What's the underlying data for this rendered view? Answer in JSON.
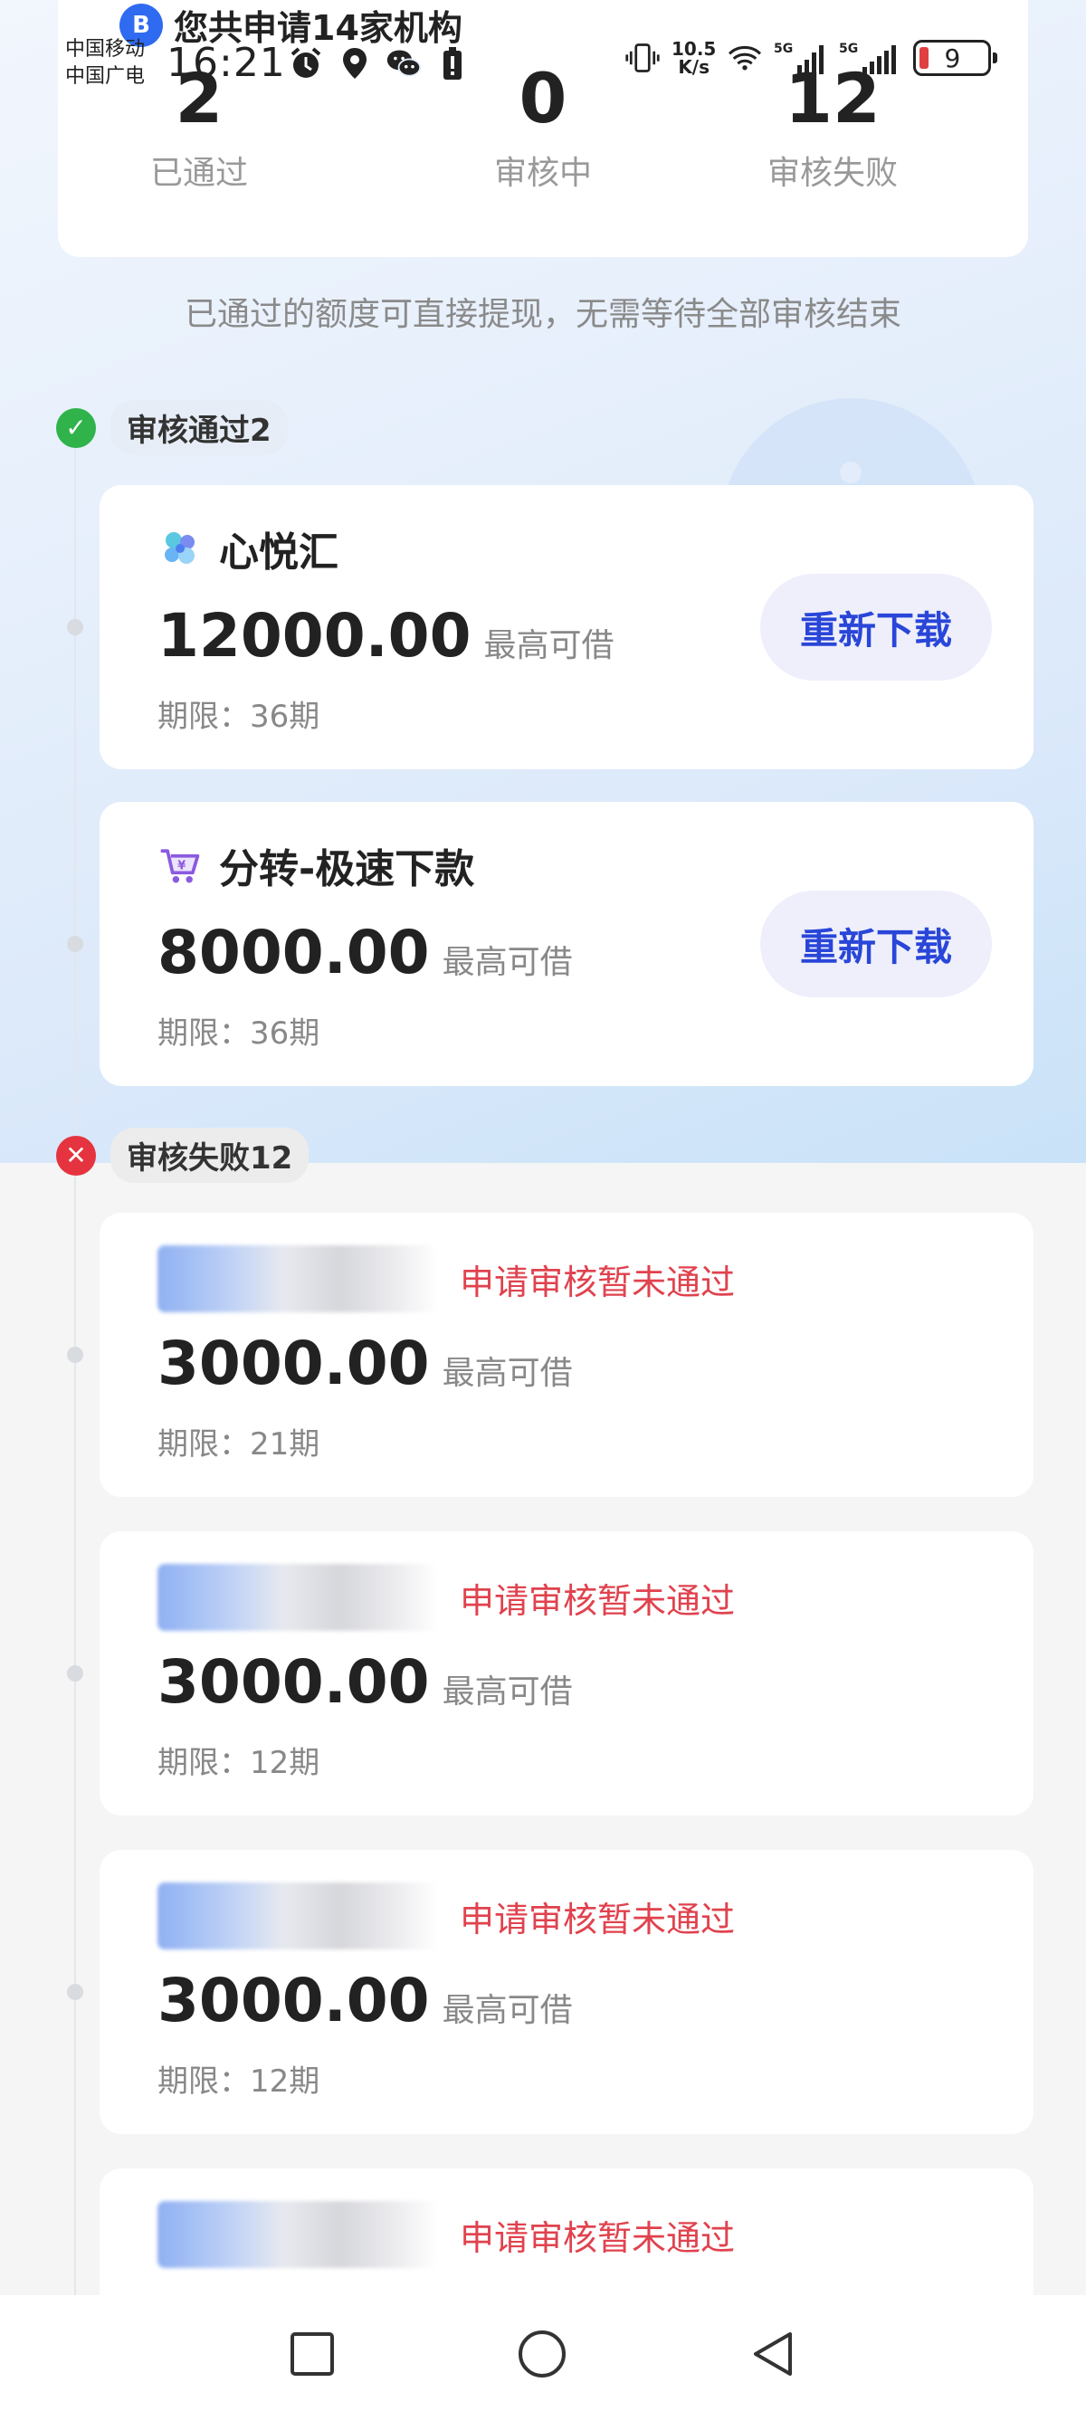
{
  "status_bar": {
    "carrier_1": "中国移动",
    "carrier_2": "中国广电",
    "time": "16:21",
    "net_speed_value": "10.5",
    "net_speed_unit": "K/s",
    "signal_1": "5G",
    "signal_2": "5G",
    "battery": "9",
    "icons_left": [
      "alarm-icon",
      "location-icon",
      "wechat-icon",
      "battery-saver-icon"
    ],
    "icons_right": [
      "vibrate-icon",
      "wifi-icon",
      "signal-icon",
      "signal-icon"
    ]
  },
  "notification": {
    "badge": "B",
    "text": "您共申请14家机构"
  },
  "summary": {
    "stats": [
      {
        "value": "2",
        "label": "已通过"
      },
      {
        "value": "0",
        "label": "审核中"
      },
      {
        "value": "12",
        "label": "审核失败"
      }
    ],
    "hint": "已通过的额度可直接提现，无需等待全部审核结束"
  },
  "sections": {
    "approved_label": "审核通过2",
    "failed_label": "审核失败12"
  },
  "approved": [
    {
      "name": "心悦汇",
      "amount": "12000.00",
      "amount_label": "最高可借",
      "term": "期限：36期",
      "button": "重新下载",
      "logo": "flower-logo-icon"
    },
    {
      "name": "分转-极速下款",
      "amount": "8000.00",
      "amount_label": "最高可借",
      "term": "期限：36期",
      "button": "重新下载",
      "logo": "cart-logo-icon"
    }
  ],
  "failed": [
    {
      "status": "申请审核暂未通过",
      "amount": "3000.00",
      "amount_label": "最高可借",
      "term": "期限：21期"
    },
    {
      "status": "申请审核暂未通过",
      "amount": "3000.00",
      "amount_label": "最高可借",
      "term": "期限：12期"
    },
    {
      "status": "申请审核暂未通过",
      "amount": "3000.00",
      "amount_label": "最高可借",
      "term": "期限：12期"
    },
    {
      "status": "申请审核暂未通过"
    }
  ],
  "nav": [
    "recent-apps-icon",
    "home-icon",
    "back-icon"
  ],
  "colors": {
    "accent": "#2946d8",
    "fail": "#e0424e",
    "ok": "#2fb34a"
  }
}
